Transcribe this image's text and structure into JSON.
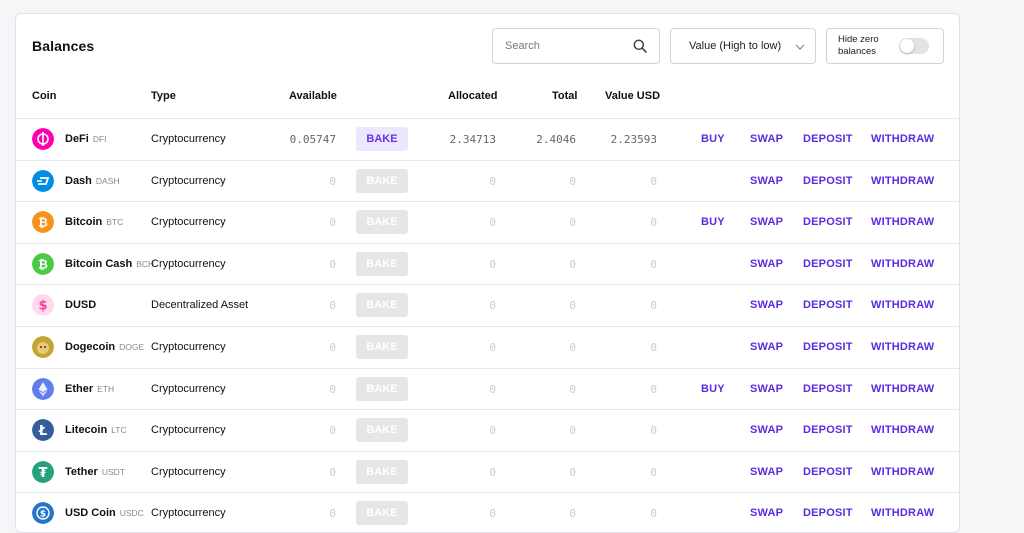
{
  "header": {
    "title": "Balances",
    "search_placeholder": "Search",
    "sort_value": "Value (High to low)",
    "hide_zero_label": "Hide zero balances",
    "hide_zero_enabled": false
  },
  "columns": {
    "coin": "Coin",
    "type": "Type",
    "available": "Available",
    "allocated": "Allocated",
    "total": "Total",
    "value_usd": "Value USD"
  },
  "actions": {
    "bake": "BAKE",
    "buy": "BUY",
    "swap": "SWAP",
    "deposit": "DEPOSIT",
    "withdraw": "WITHDRAW"
  },
  "rows": [
    {
      "name": "DeFi",
      "ticker": "DFI",
      "type": "Cryptocurrency",
      "available": "0.05747",
      "allocated": "2.34713",
      "total": "2.4046",
      "value_usd": "2.23593",
      "icon": "defi-icon",
      "color": "#ff00af",
      "bake_enabled": true,
      "buy": true
    },
    {
      "name": "Dash",
      "ticker": "DASH",
      "type": "Cryptocurrency",
      "available": "0",
      "allocated": "0",
      "total": "0",
      "value_usd": "0",
      "icon": "dash-icon",
      "color": "#008de4",
      "bake_enabled": false,
      "buy": false
    },
    {
      "name": "Bitcoin",
      "ticker": "BTC",
      "type": "Cryptocurrency",
      "available": "0",
      "allocated": "0",
      "total": "0",
      "value_usd": "0",
      "icon": "bitcoin-icon",
      "color": "#f7931a",
      "bake_enabled": false,
      "buy": true
    },
    {
      "name": "Bitcoin Cash",
      "ticker": "BCH",
      "type": "Cryptocurrency",
      "available": "0",
      "allocated": "0",
      "total": "0",
      "value_usd": "0",
      "icon": "bitcoin-cash-icon",
      "color": "#4cc947",
      "bake_enabled": false,
      "buy": false
    },
    {
      "name": "DUSD",
      "ticker": "",
      "type": "Decentralized Asset",
      "available": "0",
      "allocated": "0",
      "total": "0",
      "value_usd": "0",
      "icon": "dusd-icon",
      "color": "#ff3d9a",
      "bake_enabled": false,
      "buy": false
    },
    {
      "name": "Dogecoin",
      "ticker": "DOGE",
      "type": "Cryptocurrency",
      "available": "0",
      "allocated": "0",
      "total": "0",
      "value_usd": "0",
      "icon": "dogecoin-icon",
      "color": "#c2a633",
      "bake_enabled": false,
      "buy": false
    },
    {
      "name": "Ether",
      "ticker": "ETH",
      "type": "Cryptocurrency",
      "available": "0",
      "allocated": "0",
      "total": "0",
      "value_usd": "0",
      "icon": "ether-icon",
      "color": "#627eea",
      "bake_enabled": false,
      "buy": true
    },
    {
      "name": "Litecoin",
      "ticker": "LTC",
      "type": "Cryptocurrency",
      "available": "0",
      "allocated": "0",
      "total": "0",
      "value_usd": "0",
      "icon": "litecoin-icon",
      "color": "#345d9d",
      "bake_enabled": false,
      "buy": false
    },
    {
      "name": "Tether",
      "ticker": "USDT",
      "type": "Cryptocurrency",
      "available": "0",
      "allocated": "0",
      "total": "0",
      "value_usd": "0",
      "icon": "tether-icon",
      "color": "#26a17b",
      "bake_enabled": false,
      "buy": false
    },
    {
      "name": "USD Coin",
      "ticker": "USDC",
      "type": "Cryptocurrency",
      "available": "0",
      "allocated": "0",
      "total": "0",
      "value_usd": "0",
      "icon": "usd-coin-icon",
      "color": "#2775ca",
      "bake_enabled": false,
      "buy": false
    }
  ]
}
